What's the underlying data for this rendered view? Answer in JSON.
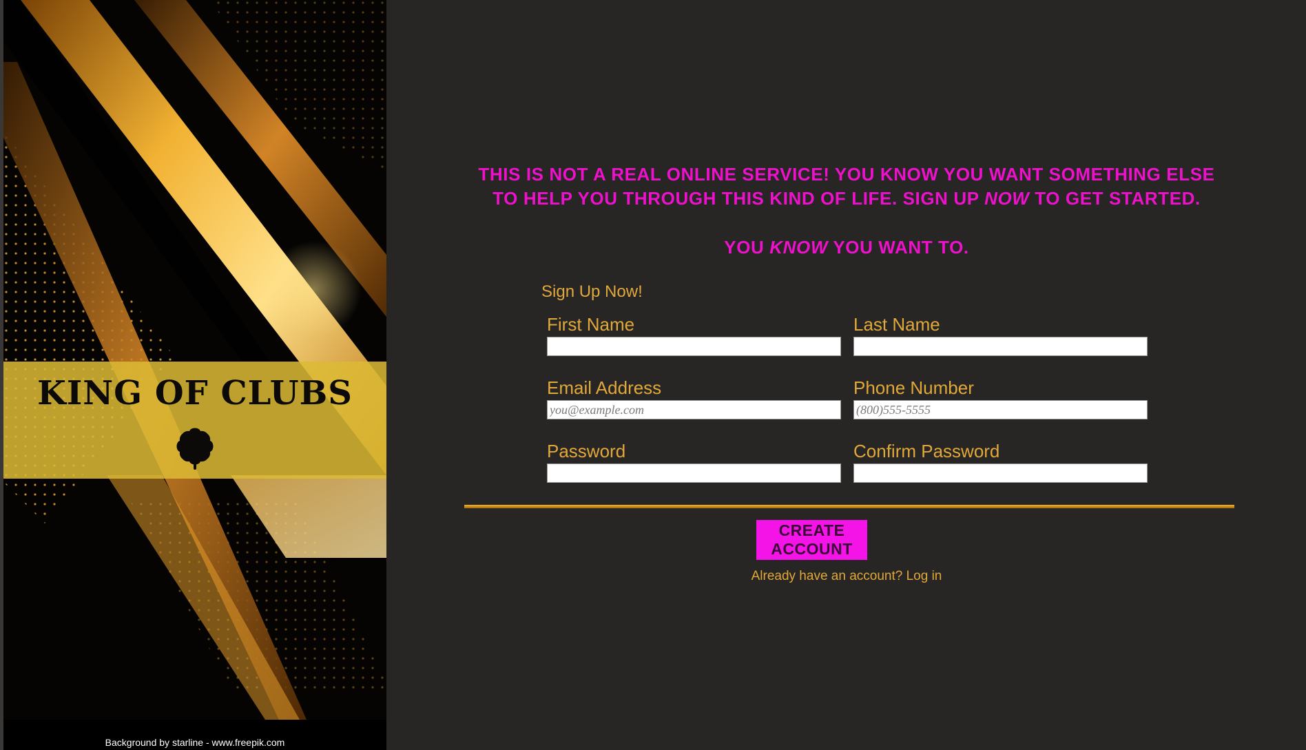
{
  "brand": {
    "name": "KING OF CLUBS",
    "icon": "clover-icon",
    "credit": "Background by starline - www.freepik.com"
  },
  "tagline": {
    "line1": "This is not a real online service! You know you want something else",
    "line2_before": "to help you through this kind of life. Sign up ",
    "line2_emphasis": "now",
    "line2_after": " to get started.",
    "line3_before": "You ",
    "line3_emphasis": "know",
    "line3_after": " you want to."
  },
  "form": {
    "heading": "Sign Up Now!",
    "fields": {
      "first_name": {
        "label": "First Name",
        "value": "",
        "placeholder": ""
      },
      "last_name": {
        "label": "Last Name",
        "value": "",
        "placeholder": ""
      },
      "email": {
        "label": "Email Address",
        "value": "",
        "placeholder": "you@example.com"
      },
      "phone": {
        "label": "Phone Number",
        "value": "",
        "placeholder": "(800)555-5555"
      },
      "password": {
        "label": "Password",
        "value": "",
        "placeholder": ""
      },
      "confirm_password": {
        "label": "Confirm Password",
        "value": "",
        "placeholder": ""
      }
    },
    "submit_label": "Create Account",
    "login_prompt": "Already have an account?",
    "login_link": "Log in"
  },
  "colors": {
    "background": "#282625",
    "accent_magenta": "#ee11cc",
    "button_magenta": "#f514e8",
    "gold": "#e1a83a",
    "band_gold": "#dcba34"
  }
}
